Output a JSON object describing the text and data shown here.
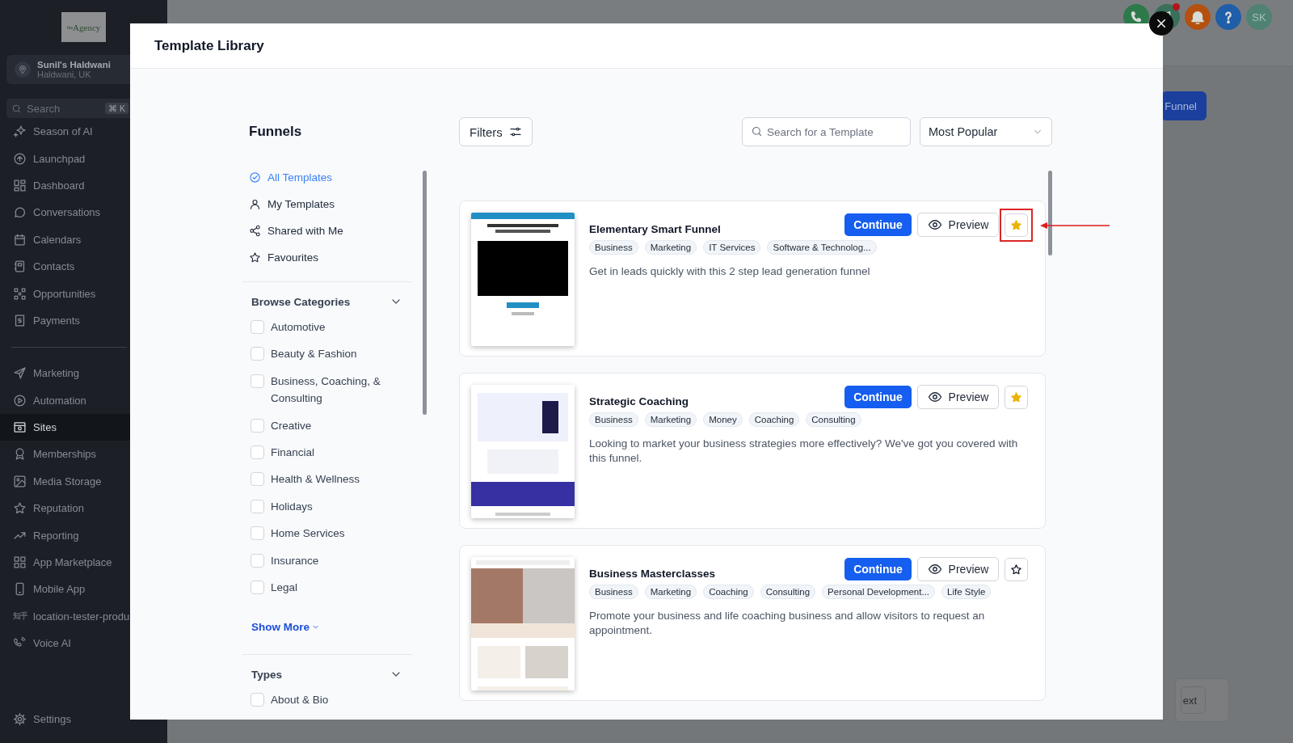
{
  "sidebar": {
    "logo": {
      "prefix": "the",
      "name": "Agency"
    },
    "account": {
      "name": "Sunil's Haldwani",
      "location": "Haldwani, UK"
    },
    "search": {
      "placeholder": "Search",
      "shortcut": "⌘ K"
    },
    "sections": [
      {
        "items": [
          {
            "label": "Season of AI",
            "selected": false
          },
          {
            "label": "Launchpad",
            "selected": false
          },
          {
            "label": "Dashboard",
            "selected": false
          },
          {
            "label": "Conversations",
            "selected": false
          },
          {
            "label": "Calendars",
            "selected": false
          },
          {
            "label": "Contacts",
            "selected": false
          },
          {
            "label": "Opportunities",
            "selected": false
          },
          {
            "label": "Payments",
            "selected": false
          }
        ]
      },
      {
        "items": [
          {
            "label": "Marketing",
            "selected": false
          },
          {
            "label": "Automation",
            "selected": false
          },
          {
            "label": "Sites",
            "selected": true
          },
          {
            "label": "Memberships",
            "selected": false
          },
          {
            "label": "Media Storage",
            "selected": false
          },
          {
            "label": "Reputation",
            "selected": false
          },
          {
            "label": "Reporting",
            "selected": false
          },
          {
            "label": "App Marketplace",
            "selected": false
          },
          {
            "label": "Mobile App",
            "selected": false
          },
          {
            "label": "location-tester-produ",
            "selected": false,
            "badge": "知乎"
          },
          {
            "label": "Voice AI",
            "selected": false
          }
        ]
      }
    ],
    "footer_items": [
      {
        "label": "Settings",
        "selected": false
      }
    ]
  },
  "topbar": {
    "icons": [
      {
        "kind": "phone",
        "dot": false
      },
      {
        "kind": "megaphone",
        "dot": true
      },
      {
        "kind": "bell",
        "dot": false
      },
      {
        "kind": "help",
        "dot": false
      }
    ],
    "avatar": "SK"
  },
  "page": {
    "primary_button": "Funnel",
    "footer_button": "ext"
  },
  "modal": {
    "title": "Template Library",
    "heading": "Funnels",
    "nav": [
      {
        "label": "All Templates",
        "selected": true
      },
      {
        "label": "My Templates",
        "selected": false
      },
      {
        "label": "Shared with Me",
        "selected": false
      },
      {
        "label": "Favourites",
        "selected": false
      }
    ],
    "filter_groups": [
      {
        "title": "Browse Categories",
        "expanded": true,
        "more": "Show More",
        "options": [
          {
            "label": "Automotive",
            "checked": false
          },
          {
            "label": "Beauty & Fashion",
            "checked": false
          },
          {
            "label": "Business, Coaching, & Consulting",
            "checked": false
          },
          {
            "label": "Creative",
            "checked": false
          },
          {
            "label": "Financial",
            "checked": false
          },
          {
            "label": "Health & Wellness",
            "checked": false
          },
          {
            "label": "Holidays",
            "checked": false
          },
          {
            "label": "Home Services",
            "checked": false
          },
          {
            "label": "Insurance",
            "checked": false
          },
          {
            "label": "Legal",
            "checked": false
          }
        ]
      },
      {
        "title": "Types",
        "expanded": true,
        "options": [
          {
            "label": "About & Bio",
            "checked": false
          }
        ]
      }
    ],
    "filters_button": "Filters",
    "search": {
      "placeholder": "Search for a Template"
    },
    "sort": {
      "value": "Most Popular"
    },
    "templates": [
      {
        "title": "Elementary Smart Funnel",
        "continue_label": "Continue",
        "preview_label": "Preview",
        "favourite": true,
        "highlighted": true,
        "tags": [
          "Business",
          "Marketing",
          "IT Services",
          "Software & Technolog..."
        ],
        "description": "Get in leads quickly with this 2 step lead generation funnel"
      },
      {
        "title": "Strategic Coaching",
        "continue_label": "Continue",
        "preview_label": "Preview",
        "favourite": true,
        "highlighted": false,
        "tags": [
          "Business",
          "Marketing",
          "Money",
          "Coaching",
          "Consulting"
        ],
        "description": "Looking to market your business strategies more effectively? We've got you covered with this funnel."
      },
      {
        "title": "Business Masterclasses",
        "continue_label": "Continue",
        "preview_label": "Preview",
        "favourite": false,
        "highlighted": false,
        "tags": [
          "Business",
          "Marketing",
          "Coaching",
          "Consulting",
          "Personal Development...",
          "Life Style"
        ],
        "description": "Promote your business and life coaching business and allow visitors to request an appointment."
      }
    ]
  }
}
